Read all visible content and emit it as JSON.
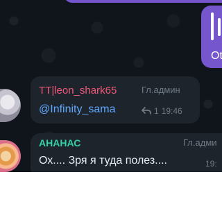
{
  "messages": [
    {
      "author": "TT|leon_shark65",
      "role": "Гл.админ",
      "text": "@Infinity_sama",
      "reply_count": "1",
      "time": "19:46"
    },
    {
      "author": "АНАНАС",
      "role": "Гл.адми",
      "text": "Ох.... Зря я туда полез....",
      "time": "19:"
    }
  ],
  "right_bubble_text": "Ot",
  "colors": {
    "background": "#10151b",
    "bubble": "#1e242c",
    "own_bubble": "#7656cc",
    "author1": "#f05a7a",
    "author2": "#33d3a8",
    "mention": "#5fa8ff",
    "meta": "#6f7a86"
  },
  "icons": {
    "reply": "reply-arrow-icon"
  }
}
